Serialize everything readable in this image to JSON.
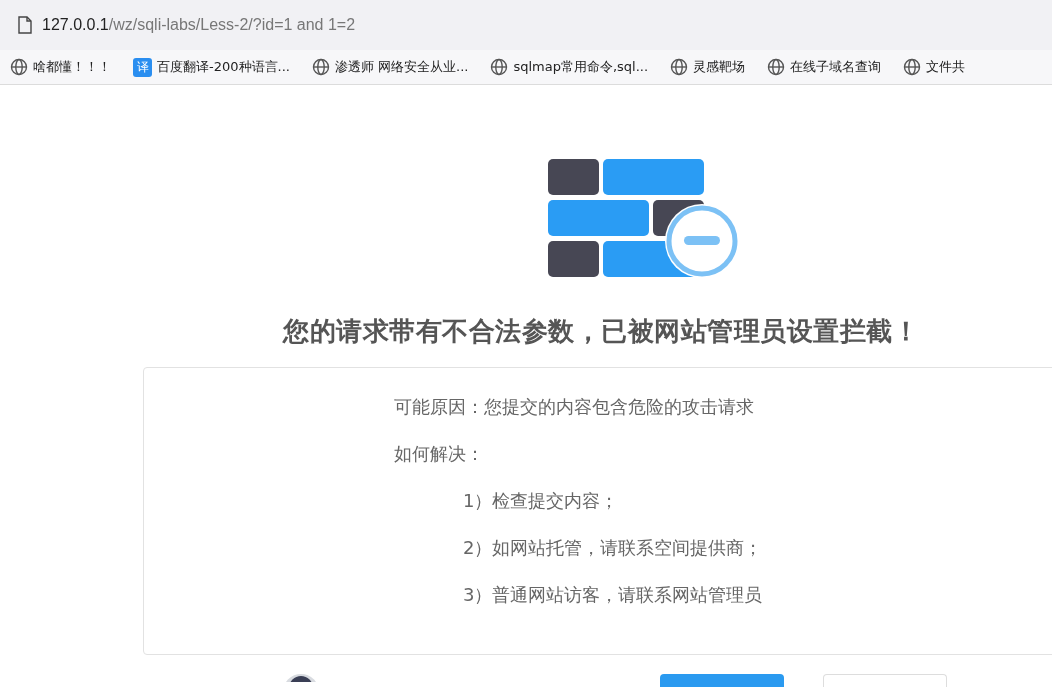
{
  "address_bar": {
    "host": "127.0.0.1",
    "path": "/wz/sqli-labs/Less-2/?id=1 and 1=2"
  },
  "bookmarks": [
    {
      "kind": "globe",
      "label": "啥都懂！！！"
    },
    {
      "kind": "badge",
      "badge": "译",
      "label": "百度翻译-200种语言..."
    },
    {
      "kind": "globe",
      "label": "渗透师 网络安全从业..."
    },
    {
      "kind": "globe",
      "label": "sqlmap常用命令,sql..."
    },
    {
      "kind": "globe",
      "label": "灵感靶场"
    },
    {
      "kind": "globe",
      "label": "在线子域名查询"
    },
    {
      "kind": "globe",
      "label": "文件共"
    }
  ],
  "heading": "您的请求带有不合法参数，已被网站管理员设置拦截！",
  "details": [
    {
      "kind": "line",
      "text": "可能原因：您提交的内容包含危险的攻击请求"
    },
    {
      "kind": "line",
      "text": "如何解决："
    },
    {
      "kind": "step",
      "text": "1）检查提交内容；"
    },
    {
      "kind": "step",
      "text": "2）如网站托管，请联系空间提供商；"
    },
    {
      "kind": "step",
      "text": "3）普通网站访客，请联系网站管理员"
    }
  ]
}
